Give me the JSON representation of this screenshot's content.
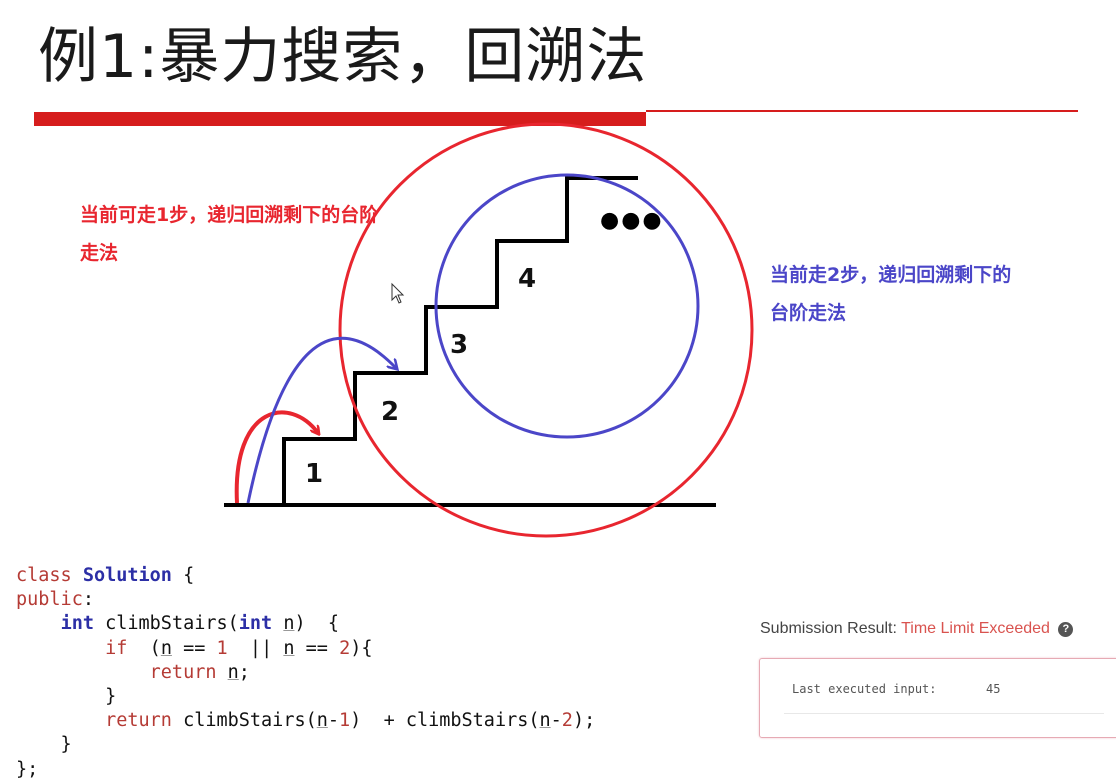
{
  "slide": {
    "title": "例1:暴力搜索，回溯法",
    "accent_color": "#d61d1d"
  },
  "diagram": {
    "step_labels": [
      "1",
      "2",
      "3",
      "4"
    ],
    "continuation_mark": "●●●",
    "note_one_step": "当前可走1步，递归回溯剩下的台阶走法",
    "note_two_steps": "当前走2步，递归回溯剩下的台阶走法",
    "red_color": "#e8262f",
    "blue_color": "#4b46c8",
    "cursor_icon": "mouse-pointer-icon"
  },
  "code": {
    "lines": [
      "class Solution {",
      "public:",
      "    int climbStairs(int n) {",
      "        if (n == 1 || n == 2){",
      "            return n;",
      "        }",
      "        return climbStairs(n-1) + climbStairs(n-2);",
      "    }",
      "};"
    ]
  },
  "result": {
    "title_label": "Submission Result:",
    "status": "Time Limit Exceeded",
    "help_icon": "question-circle-icon",
    "input_label": "Last executed input:",
    "input_value": "45"
  }
}
